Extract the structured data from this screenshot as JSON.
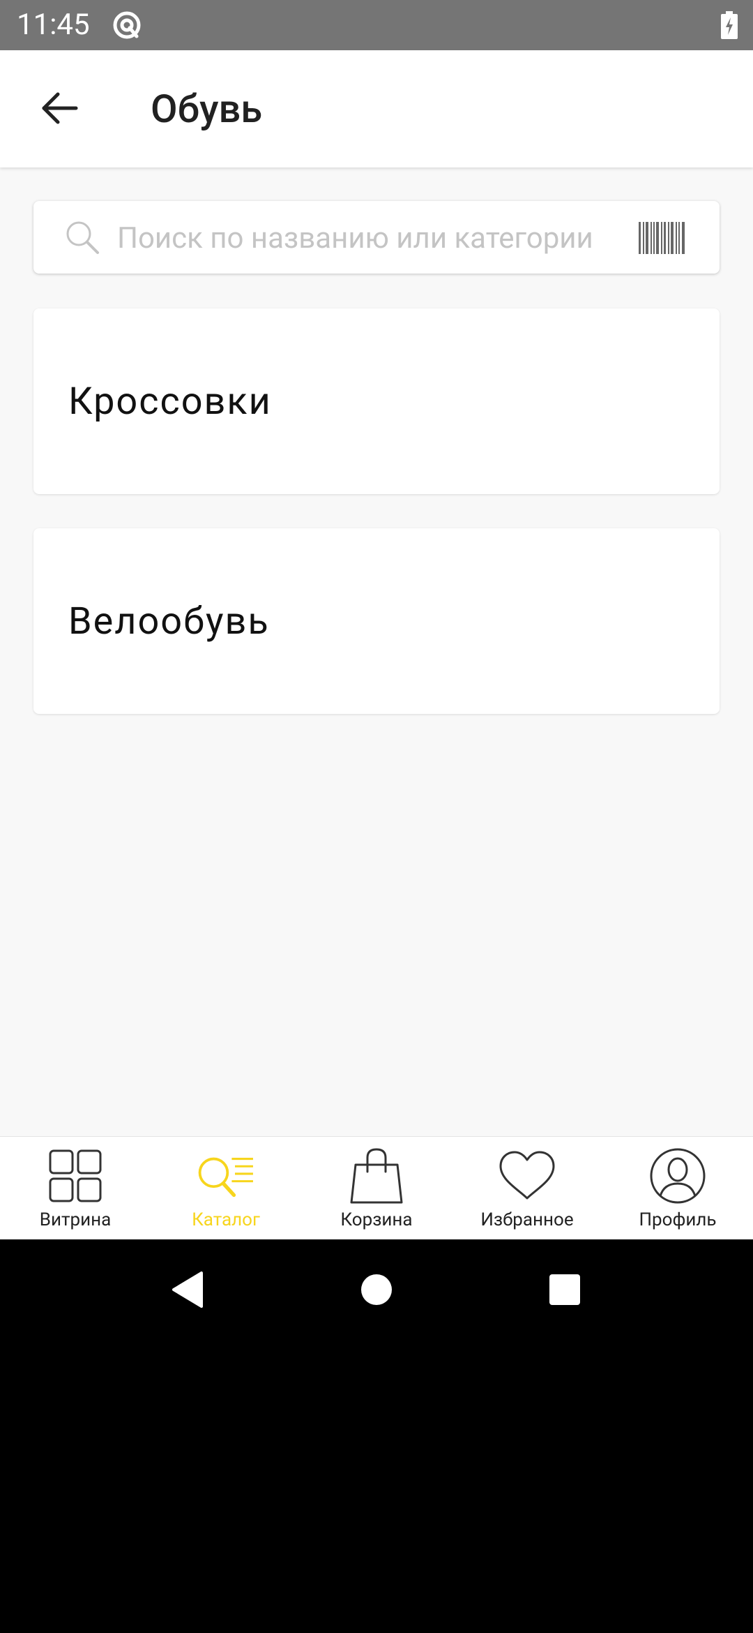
{
  "status_bar": {
    "time": "11:45",
    "notification_icon": "at-sign-circle-icon",
    "battery_icon": "battery-charging-icon"
  },
  "app_bar": {
    "back_icon": "arrow-left-icon",
    "title": "Обувь"
  },
  "search": {
    "placeholder": "Поиск по названию или категории",
    "value": "",
    "icon": "search-icon",
    "barcode_icon": "barcode-icon"
  },
  "categories": [
    {
      "label": "Кроссовки"
    },
    {
      "label": "Велообувь"
    }
  ],
  "bottom_nav": {
    "active_index": 1,
    "active_color": "#f7d51d",
    "items": [
      {
        "label": "Витрина",
        "icon": "grid-icon"
      },
      {
        "label": "Каталог",
        "icon": "catalog-search-icon"
      },
      {
        "label": "Корзина",
        "icon": "shopping-bag-icon"
      },
      {
        "label": "Избранное",
        "icon": "heart-icon"
      },
      {
        "label": "Профиль",
        "icon": "profile-icon"
      }
    ]
  },
  "system_nav": {
    "back_icon": "triangle-back-icon",
    "home_icon": "circle-home-icon",
    "recents_icon": "square-recents-icon"
  }
}
